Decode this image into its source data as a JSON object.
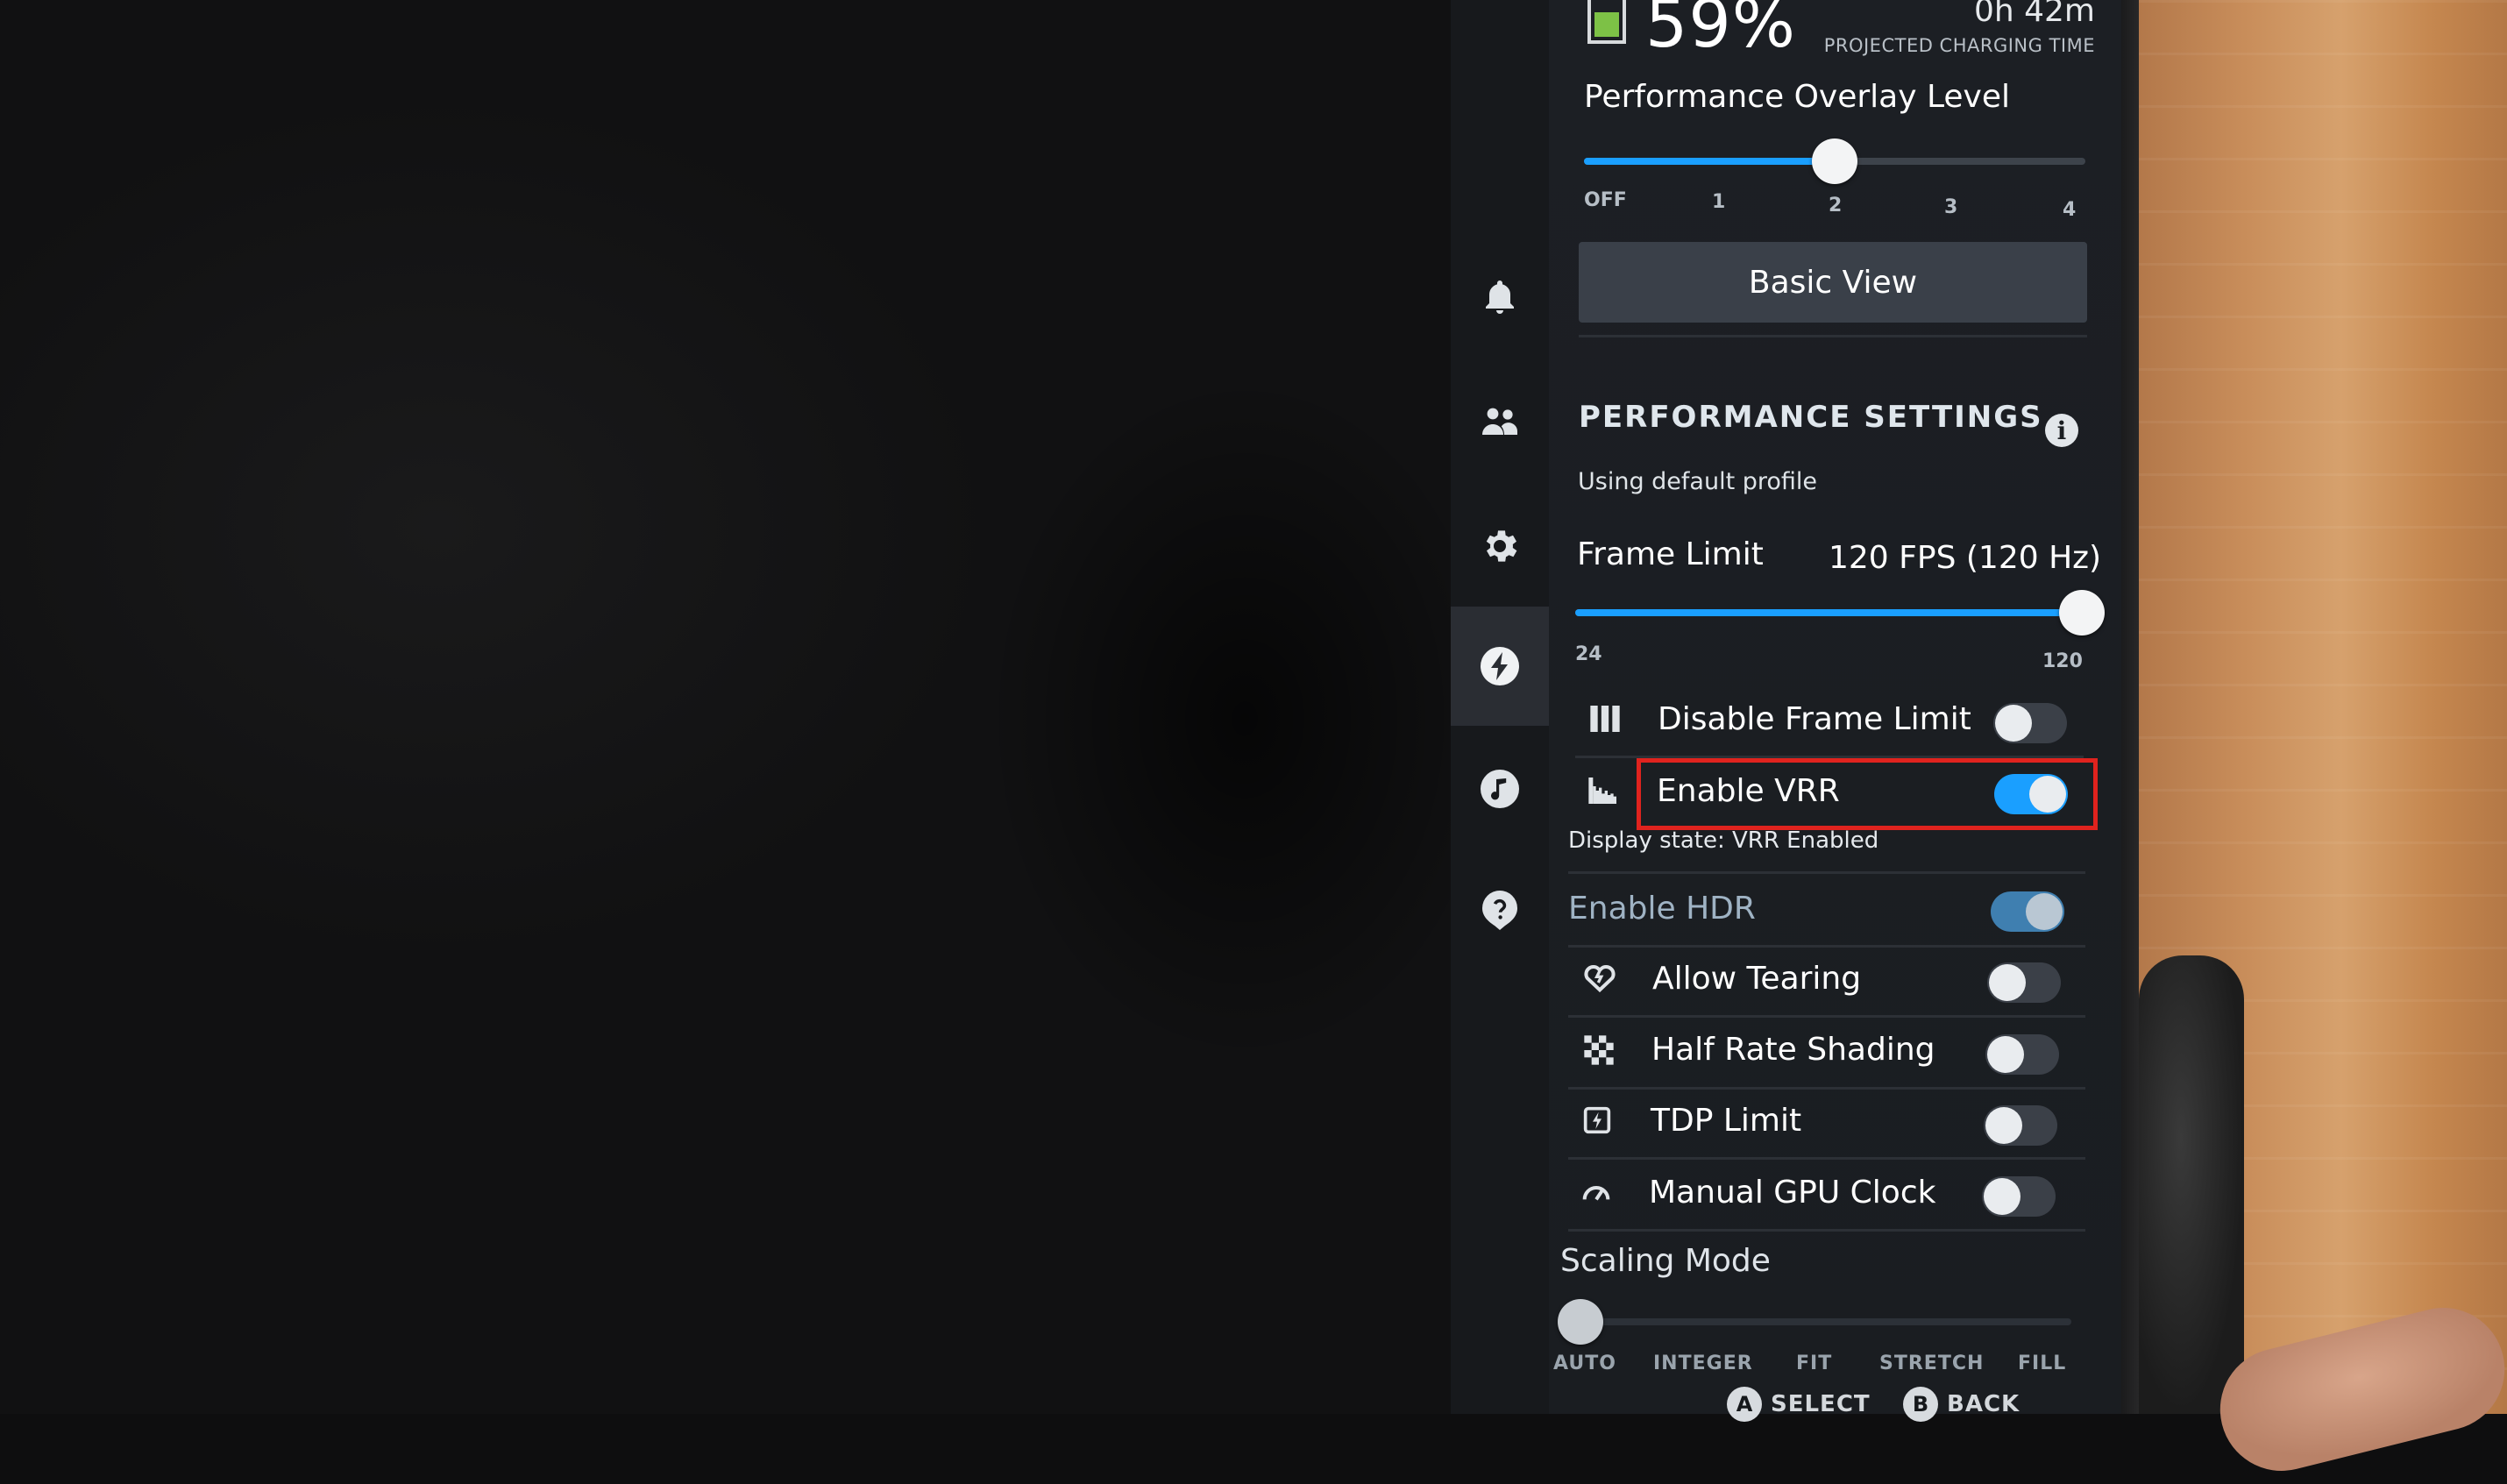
{
  "status": {
    "battery_percent": "59%",
    "charge_time": "0h 42m",
    "charge_caption": "PROJECTED CHARGING TIME",
    "battery_fill_fraction": 0.59
  },
  "nav": {
    "items": [
      {
        "icon": "bell-icon"
      },
      {
        "icon": "friends-icon"
      },
      {
        "icon": "gear-icon"
      },
      {
        "icon": "lightning-icon",
        "active": true
      },
      {
        "icon": "music-icon"
      },
      {
        "icon": "help-icon"
      }
    ]
  },
  "overlay": {
    "title": "Performance Overlay Level",
    "ticks": [
      "OFF",
      "1",
      "2",
      "3",
      "4"
    ],
    "value_index": 2,
    "basic_view_label": "Basic View"
  },
  "performance": {
    "title": "PERFORMANCE SETTINGS",
    "profile_text": "Using default profile",
    "frame_limit_label": "Frame Limit",
    "frame_limit_value": "120 FPS (120 Hz)",
    "frame_limit_min": "24",
    "frame_limit_max": "120",
    "frame_limit_fraction": 1.0
  },
  "toggles": {
    "disable_frame_limit": {
      "label": "Disable Frame Limit",
      "on": false,
      "icon": "bars-icon"
    },
    "enable_vrr": {
      "label": "Enable VRR",
      "on": true,
      "icon": "vrr-chart-icon"
    },
    "display_state": "Display state: VRR Enabled",
    "enable_hdr": {
      "label": "Enable HDR",
      "on": true,
      "disabled": true
    },
    "allow_tearing": {
      "label": "Allow Tearing",
      "on": false,
      "icon": "broken-heart-icon"
    },
    "half_rate_shading": {
      "label": "Half Rate Shading",
      "on": false,
      "icon": "checker-icon"
    },
    "tdp_limit": {
      "label": "TDP Limit",
      "on": false,
      "icon": "chip-icon"
    },
    "manual_gpu_clock": {
      "label": "Manual GPU Clock",
      "on": false,
      "icon": "gauge-icon"
    }
  },
  "scaling": {
    "title": "Scaling Mode",
    "options": [
      "AUTO",
      "INTEGER",
      "FIT",
      "STRETCH",
      "FILL"
    ],
    "value_index": 0
  },
  "footer": {
    "select_glyph": "A",
    "select_label": "SELECT",
    "back_glyph": "B",
    "back_label": "BACK"
  },
  "colors": {
    "accent": "#1a9fff",
    "highlight_box": "#e0231e",
    "battery": "#7dc146"
  }
}
